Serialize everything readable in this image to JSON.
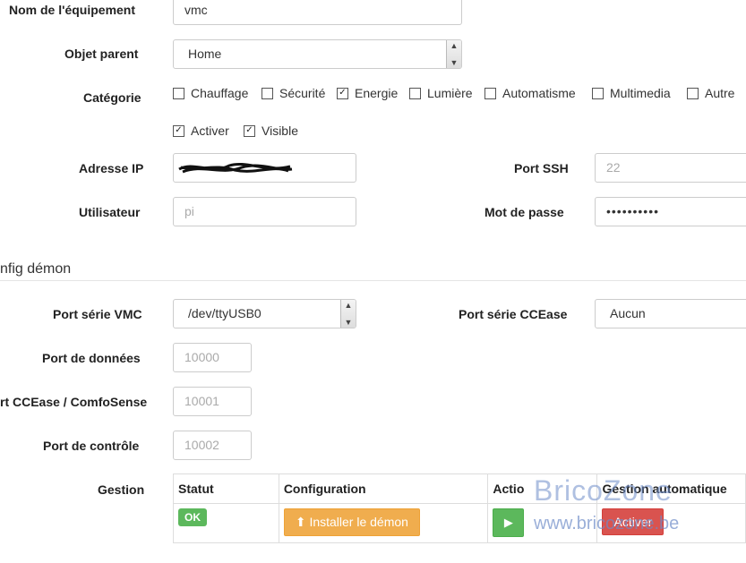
{
  "form": {
    "nom_label": "Nom de l'équipement",
    "nom_value": "vmc",
    "parent_label": "Objet parent",
    "parent_value": "Home",
    "categorie_label": "Catégorie",
    "categories": [
      {
        "label": "Chauffage",
        "checked": false
      },
      {
        "label": "Sécurité",
        "checked": false
      },
      {
        "label": "Energie",
        "checked": true
      },
      {
        "label": "Lumière",
        "checked": false
      },
      {
        "label": "Automatisme",
        "checked": false
      },
      {
        "label": "Multimedia",
        "checked": false
      },
      {
        "label": "Autre",
        "checked": false
      }
    ],
    "activer_label": "Activer",
    "activer_checked": true,
    "visible_label": "Visible",
    "visible_checked": true,
    "ip_label": "Adresse IP",
    "port_ssh_label": "Port SSH",
    "port_ssh_placeholder": "22",
    "user_label": "Utilisateur",
    "user_placeholder": "pi",
    "password_label": "Mot de passe",
    "password_value": "••••••••••"
  },
  "daemon": {
    "section_title": "nfig démon",
    "port_vmc_label": "Port série VMC",
    "port_vmc_value": "/dev/ttyUSB0",
    "port_ccease_label": "Port série CCEase",
    "port_ccease_value": "Aucun",
    "port_donnees_label": "Port de données",
    "port_donnees_placeholder": "10000",
    "port_comfo_label": "rt CCEase / ComfoSense",
    "port_comfo_placeholder": "10001",
    "port_controle_label": "Port de contrôle",
    "port_controle_placeholder": "10002"
  },
  "gestion": {
    "label": "Gestion",
    "headers": [
      "Statut",
      "Configuration",
      "Actio",
      "Gestion automatique"
    ],
    "status_badge": "OK",
    "install_button": "Installer le démon",
    "auto_button": "Activer"
  },
  "watermark": {
    "brand": "BricoZone",
    "url": "www.bricozone.be"
  }
}
